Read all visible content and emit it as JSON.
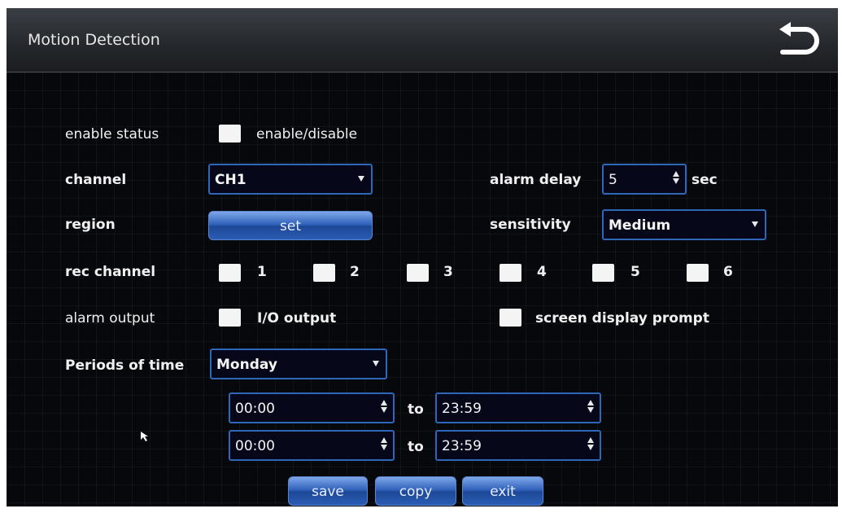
{
  "window": {
    "title": "Motion Detection"
  },
  "form": {
    "enable_status_label": "enable status",
    "enable_option_label": "enable/disable",
    "channel_label": "channel",
    "channel_value": "CH1",
    "alarm_delay_label": "alarm delay",
    "alarm_delay_value": "5",
    "alarm_delay_unit": "sec",
    "region_label": "region",
    "region_button": "set",
    "sensitivity_label": "sensitivity",
    "sensitivity_value": "Medium",
    "rec_channel_label": "rec channel",
    "rec_channels": [
      "1",
      "2",
      "3",
      "4",
      "5",
      "6"
    ],
    "alarm_output_label": "alarm output",
    "io_output_label": "I/O output",
    "screen_prompt_label": "screen display prompt",
    "periods_label": "Periods of time",
    "period_day": "Monday",
    "period1_from": "00:00",
    "period1_to": "23:59",
    "period2_from": "00:00",
    "period2_to": "23:59",
    "to_label": "to"
  },
  "buttons": {
    "save": "save",
    "copy": "copy",
    "exit": "exit"
  },
  "icons": {
    "back": "return-arrow-icon",
    "cursor": "mouse-pointer-icon"
  },
  "colors": {
    "accent_border": "#2f67b8",
    "button_blue": "#2d5fb8",
    "background": "#07080b"
  }
}
